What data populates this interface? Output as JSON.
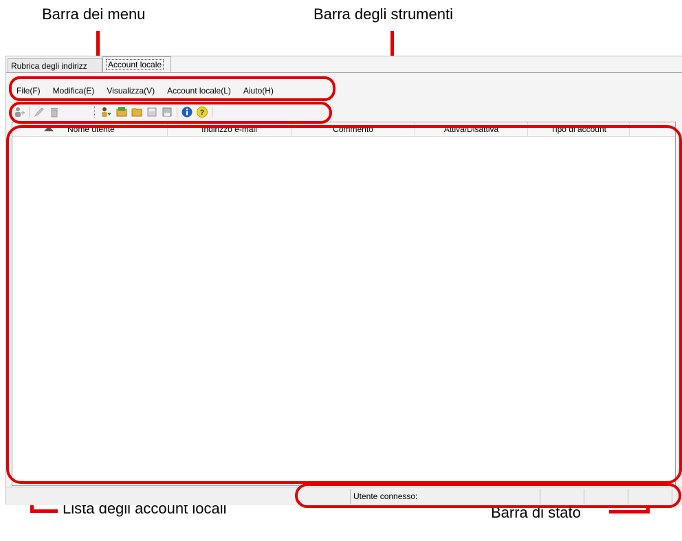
{
  "callouts": {
    "menu_bar": "Barra dei menu",
    "toolbar": "Barra degli strumenti",
    "account_list": "Lista degli account locali",
    "status_bar": "Barra di stato"
  },
  "tabs": [
    {
      "label": "Rubrica degli indirizz"
    },
    {
      "label": "Account locale"
    }
  ],
  "menu": [
    {
      "label": "File(F)"
    },
    {
      "label": "Modifica(E)"
    },
    {
      "label": "Visualizza(V)"
    },
    {
      "label": "Account locale(L)"
    },
    {
      "label": "Aiuto(H)"
    }
  ],
  "toolbar": {
    "icons": [
      "add-user-icon",
      "edit-icon",
      "delete-icon",
      "import-user-icon",
      "folder-green-icon",
      "folder-icon",
      "save-disabled-icon",
      "save-icon",
      "info-icon",
      "help-icon"
    ]
  },
  "list": {
    "columns": [
      {
        "label": ""
      },
      {
        "label": "Nome utente"
      },
      {
        "label": "Indirizzo e-mail"
      },
      {
        "label": "Commento"
      },
      {
        "label": "Attiva/Disattiva"
      },
      {
        "label": "Tipo di account"
      }
    ],
    "sort_direction": "ascending"
  },
  "status": {
    "connected_user_label": "Utente connesso:"
  },
  "colors": {
    "highlight": "#e00000"
  }
}
